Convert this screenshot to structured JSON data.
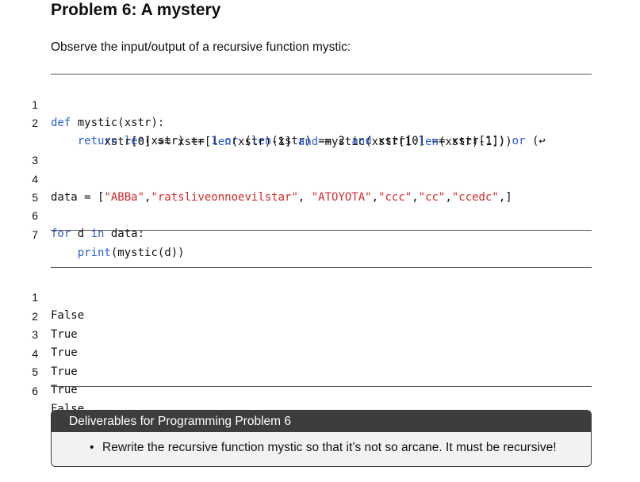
{
  "header": {
    "title": "Problem 6: A mystery",
    "intro": "Observe the input/output of a recursive function mystic:"
  },
  "code_listing": {
    "lines": [
      {
        "number": "1"
      },
      {
        "number": "2"
      },
      {
        "number": ""
      },
      {
        "number": "3"
      },
      {
        "number": "4"
      },
      {
        "number": "5"
      },
      {
        "number": "6"
      },
      {
        "number": "7"
      }
    ],
    "tokens": {
      "l1_def": "def",
      "l1_rest": " mystic(xstr):",
      "l2_indent": "    ",
      "l2_return": "return",
      "l2_a": " ",
      "l2_len1": "len",
      "l2_b": "(xstr) == 1 ",
      "l2_or1": "or",
      "l2_c": " (",
      "l2_len2": "len",
      "l2_d": "(xstr) == 2 ",
      "l2_and1": "and",
      "l2_e": " xstr[0] == xstr[1]) ",
      "l2_or2": "or",
      "l2_f": " (↩",
      "l2c_indent": "       ",
      "l2c_a": " xstr[0] == xstr[",
      "l2c_len": "len",
      "l2c_b": "(xstr)-1] ",
      "l2c_and": "and",
      "l2c_c": " mystic(xstr[1:",
      "l2c_len2": "len",
      "l2c_d": "(xstr)-1]))",
      "l4_a": "data = [",
      "l4_s1": "\"ABBa\"",
      "l4_c1": ",",
      "l4_s2": "\"ratsliveonnoevilstar\"",
      "l4_c2": ", ",
      "l4_s3": "\"ATOYOTA\"",
      "l4_c3": ",",
      "l4_s4": "\"ccc\"",
      "l4_c4": ",",
      "l4_s5": "\"cc\"",
      "l4_c5": ",",
      "l4_s6": "\"ccedc\"",
      "l4_end": ",]",
      "l6_for": "for",
      "l6_a": " d ",
      "l6_in": "in",
      "l6_b": " data:",
      "l7_indent": "    ",
      "l7_print": "print",
      "l7_rest": "(mystic(d))"
    }
  },
  "output_listing": {
    "lines": [
      {
        "number": "1",
        "text": "False"
      },
      {
        "number": "2",
        "text": "True"
      },
      {
        "number": "3",
        "text": "True"
      },
      {
        "number": "4",
        "text": "True"
      },
      {
        "number": "5",
        "text": "True"
      },
      {
        "number": "6",
        "text": "False"
      }
    ]
  },
  "deliverables": {
    "heading": "Deliverables for Programming Problem 6",
    "bullet_symbol": "•",
    "item": "Rewrite the recursive function mystic so that it’s not so arcane.  It must be recursive!"
  },
  "colors": {
    "keyword": "#2a5bd7",
    "string": "#d32828",
    "box_header": "#3d3d3d",
    "box_body": "#f2f2f2"
  }
}
